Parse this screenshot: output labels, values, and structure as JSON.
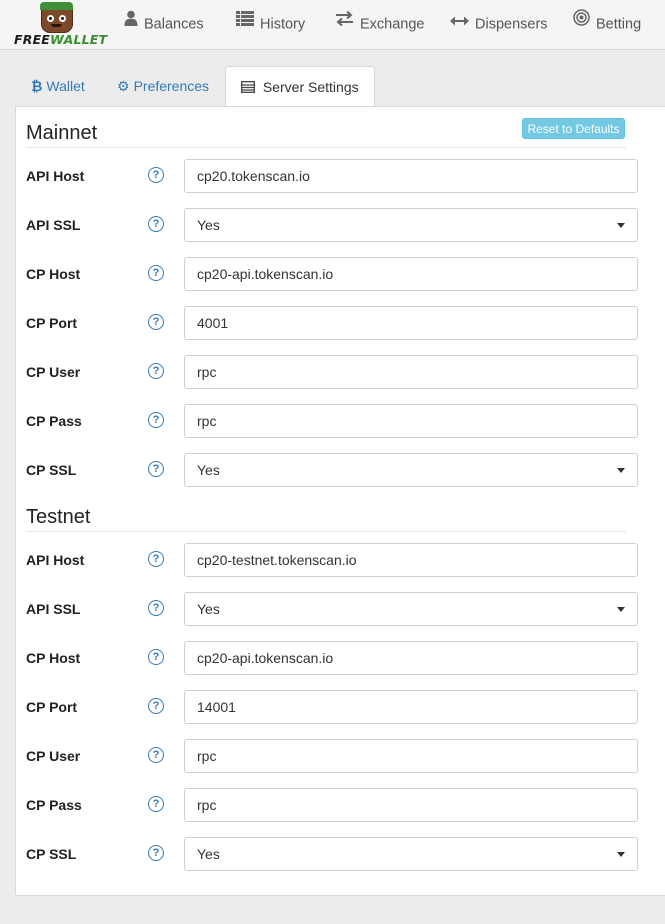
{
  "brand": {
    "part1": "FREE",
    "part2": "WALLET"
  },
  "nav": [
    {
      "label": "Balances",
      "icon": "user-icon"
    },
    {
      "label": "History",
      "icon": "list-icon"
    },
    {
      "label": "Exchange",
      "icon": "exchange-arrows-icon"
    },
    {
      "label": "Dispensers",
      "icon": "left-right-arrow-icon"
    },
    {
      "label": "Betting",
      "icon": "target-icon"
    }
  ],
  "tabs": {
    "wallet": {
      "label": "Wallet",
      "icon": "bitcoin-icon"
    },
    "preferences": {
      "label": "Preferences",
      "icon": "gear-icon"
    },
    "server": {
      "label": "Server Settings",
      "icon": "server-list-icon"
    }
  },
  "reset_label": "Reset to Defaults",
  "help_glyph": "?",
  "mainnet": {
    "title": "Mainnet",
    "rows": [
      {
        "label": "API Host",
        "value": "cp20.tokenscan.io"
      },
      {
        "label": "API SSL",
        "value": "Yes"
      },
      {
        "label": "CP Host",
        "value": "cp20-api.tokenscan.io"
      },
      {
        "label": "CP Port",
        "value": "4001"
      },
      {
        "label": "CP User",
        "value": "rpc"
      },
      {
        "label": "CP Pass",
        "value": "rpc"
      },
      {
        "label": "CP SSL",
        "value": "Yes"
      }
    ]
  },
  "testnet": {
    "title": "Testnet",
    "rows": [
      {
        "label": "API Host",
        "value": "cp20-testnet.tokenscan.io"
      },
      {
        "label": "API SSL",
        "value": "Yes"
      },
      {
        "label": "CP Host",
        "value": "cp20-api.tokenscan.io"
      },
      {
        "label": "CP Port",
        "value": "14001"
      },
      {
        "label": "CP User",
        "value": "rpc"
      },
      {
        "label": "CP Pass",
        "value": "rpc"
      },
      {
        "label": "CP SSL",
        "value": "Yes"
      }
    ]
  },
  "colors": {
    "link": "#337ab7",
    "reset_button": "#5bc0de",
    "brand_green": "#3a8f2f"
  }
}
